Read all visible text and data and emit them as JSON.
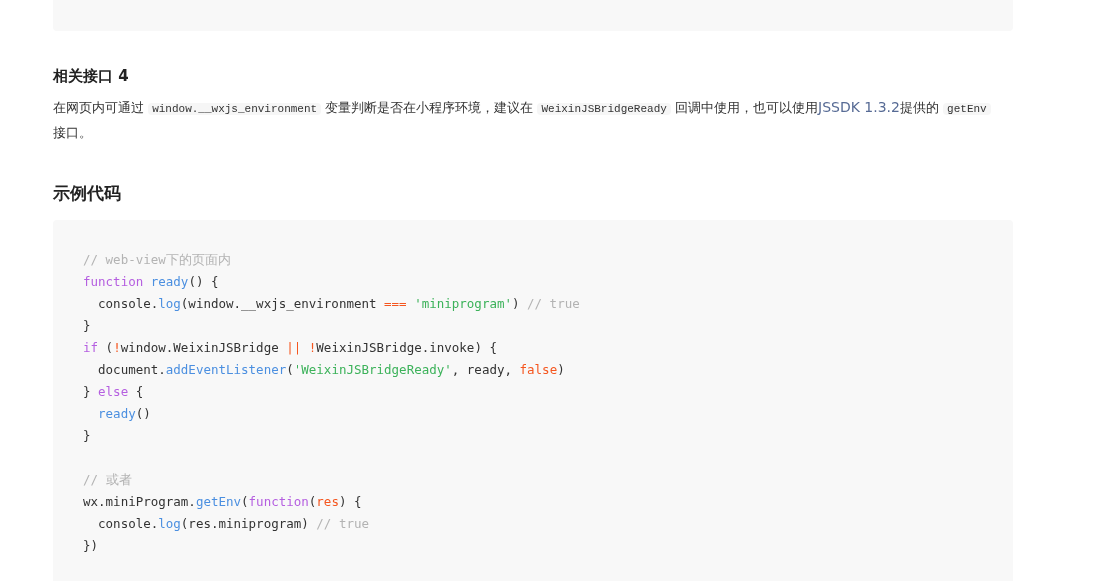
{
  "section": {
    "heading": "相关接口 4",
    "paragraph": [
      {
        "kind": "text",
        "text": "在网页内可通过 "
      },
      {
        "kind": "code",
        "text": "window.__wxjs_environment"
      },
      {
        "kind": "text",
        "text": " 变量判断是否在小程序环境，建议在 "
      },
      {
        "kind": "code",
        "text": "WeixinJSBridgeReady"
      },
      {
        "kind": "text",
        "text": " 回调中使用，也可以使用"
      },
      {
        "kind": "link",
        "text": "JSSDK 1.3.2"
      },
      {
        "kind": "text",
        "text": "提供的 "
      },
      {
        "kind": "code",
        "text": "getEnv"
      },
      {
        "kind": "text",
        "text": " 接口。"
      }
    ]
  },
  "example": {
    "heading": "示例代码",
    "lines": [
      [
        {
          "kind": "comment",
          "text": "// web-view下的页面内"
        }
      ],
      [
        {
          "kind": "keyword",
          "text": "function"
        },
        {
          "kind": "func",
          "text": " ready"
        },
        {
          "kind": "plain",
          "text": "() {"
        }
      ],
      [
        {
          "kind": "plain",
          "text": "  console."
        },
        {
          "kind": "func",
          "text": "log"
        },
        {
          "kind": "plain",
          "text": "(window.__wxjs_environment "
        },
        {
          "kind": "operator",
          "text": "==="
        },
        {
          "kind": "string",
          "text": " 'miniprogram'"
        },
        {
          "kind": "plain",
          "text": ") "
        },
        {
          "kind": "comment",
          "text": "// true"
        }
      ],
      [
        {
          "kind": "plain",
          "text": "}"
        }
      ],
      [
        {
          "kind": "keyword",
          "text": "if"
        },
        {
          "kind": "plain",
          "text": " ("
        },
        {
          "kind": "operator",
          "text": "!"
        },
        {
          "kind": "plain",
          "text": "window.WeixinJSBridge "
        },
        {
          "kind": "operator",
          "text": "|| !"
        },
        {
          "kind": "plain",
          "text": "WeixinJSBridge.invoke) {"
        }
      ],
      [
        {
          "kind": "plain",
          "text": "  document."
        },
        {
          "kind": "func",
          "text": "addEventListener"
        },
        {
          "kind": "plain",
          "text": "("
        },
        {
          "kind": "string",
          "text": "'WeixinJSBridgeReady'"
        },
        {
          "kind": "plain",
          "text": ", ready, "
        },
        {
          "kind": "operator",
          "text": "false"
        },
        {
          "kind": "plain",
          "text": ")"
        }
      ],
      [
        {
          "kind": "plain",
          "text": "} "
        },
        {
          "kind": "keyword",
          "text": "else"
        },
        {
          "kind": "plain",
          "text": " {"
        }
      ],
      [
        {
          "kind": "func",
          "text": "  ready"
        },
        {
          "kind": "plain",
          "text": "()"
        }
      ],
      [
        {
          "kind": "plain",
          "text": "}"
        }
      ],
      [
        {
          "kind": "blank"
        }
      ],
      [
        {
          "kind": "comment",
          "text": "// 或者"
        }
      ],
      [
        {
          "kind": "plain",
          "text": "wx.miniProgram."
        },
        {
          "kind": "func",
          "text": "getEnv"
        },
        {
          "kind": "plain",
          "text": "("
        },
        {
          "kind": "keyword",
          "text": "function"
        },
        {
          "kind": "plain",
          "text": "("
        },
        {
          "kind": "operator",
          "text": "res"
        },
        {
          "kind": "plain",
          "text": ") {"
        }
      ],
      [
        {
          "kind": "plain",
          "text": "  console."
        },
        {
          "kind": "func",
          "text": "log"
        },
        {
          "kind": "plain",
          "text": "(res.miniprogram) "
        },
        {
          "kind": "comment",
          "text": "// true"
        }
      ],
      [
        {
          "kind": "plain",
          "text": "})"
        }
      ]
    ]
  }
}
